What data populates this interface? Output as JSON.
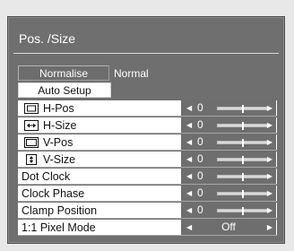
{
  "menu": {
    "title": "Pos. /Size",
    "normalise_label": "Normalise",
    "normal_status": "Normal",
    "auto_setup_label": "Auto Setup",
    "items": [
      {
        "label": "H-Pos",
        "icon": "h-pos-icon",
        "value": "0"
      },
      {
        "label": "H-Size",
        "icon": "h-size-icon",
        "value": "0"
      },
      {
        "label": "V-Pos",
        "icon": "v-pos-icon",
        "value": "0"
      },
      {
        "label": "V-Size",
        "icon": "v-size-icon",
        "value": "0"
      },
      {
        "label": "Dot Clock",
        "value": "0"
      },
      {
        "label": "Clock Phase",
        "value": "0"
      },
      {
        "label": "Clamp Position",
        "value": "0"
      },
      {
        "label": "1:1 Pixel Mode",
        "value": "Off"
      }
    ]
  },
  "colors": {
    "panel": "#6f6f6f",
    "row_bg": "#ffffff",
    "control_bg": "#6e6e6e",
    "text_dark": "#111111",
    "text_light": "#ffffff"
  }
}
